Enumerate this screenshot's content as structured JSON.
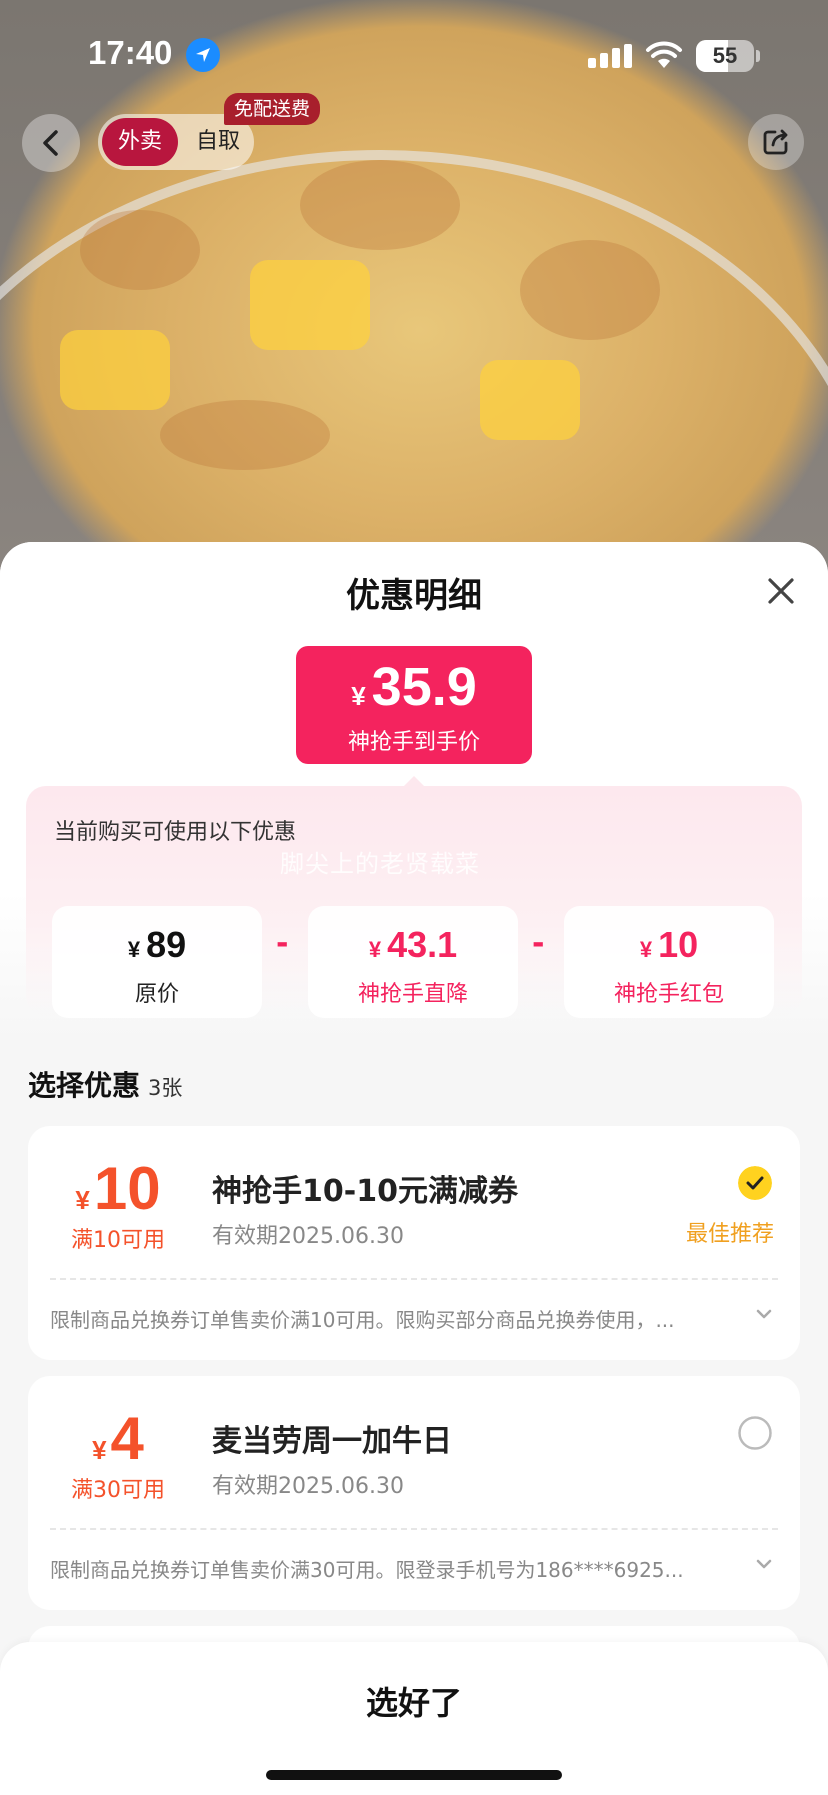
{
  "status_bar": {
    "time": "17:40",
    "battery": "55"
  },
  "nav": {
    "mode_active": "外卖",
    "mode_inactive": "自取",
    "free_delivery_badge": "免配送费"
  },
  "sheet": {
    "title": "优惠明细",
    "price": {
      "currency": "¥",
      "value": "35.9",
      "label": "神抢手到手价"
    },
    "breakdown": {
      "title": "当前购买可使用以下优惠",
      "watermark": "脚尖上的老贤载菜",
      "items": [
        {
          "currency": "¥",
          "value": "89",
          "label": "原价",
          "color": "#111111"
        },
        {
          "currency": "¥",
          "value": "43.1",
          "label": "神抢手直降",
          "color": "#f4235e"
        },
        {
          "currency": "¥",
          "value": "10",
          "label": "神抢手红包",
          "color": "#f4235e"
        }
      ],
      "operator": "-"
    },
    "select": {
      "title": "选择优惠",
      "count": "3张"
    },
    "coupons": [
      {
        "currency": "¥",
        "amount": "10",
        "condition": "满10可用",
        "name": "神抢手10-10元满减券",
        "expiry": "有效期2025.06.30",
        "selected": true,
        "tag": "最佳推荐",
        "desc": "限制商品兑换券订单售卖价满10可用。限购买部分商品兑换券使用，..."
      },
      {
        "currency": "¥",
        "amount": "4",
        "condition": "满30可用",
        "name": "麦当劳周一加牛日",
        "expiry": "有效期2025.06.30",
        "selected": false,
        "tag": "",
        "desc": "限制商品兑换券订单售卖价满30可用。限登录手机号为186****6925..."
      }
    ],
    "confirm_label": "选好了"
  },
  "colors": {
    "accent": "#f4235e",
    "coupon_red": "#f4522b",
    "best": "#f0a020",
    "check_yellow": "#ffd21f"
  },
  "icons": [
    "location-arrow-icon",
    "signal-icon",
    "wifi-icon",
    "battery-icon",
    "back-chevron-icon",
    "share-icon",
    "close-icon",
    "check-icon",
    "radio-empty-icon",
    "chevron-down-icon"
  ]
}
